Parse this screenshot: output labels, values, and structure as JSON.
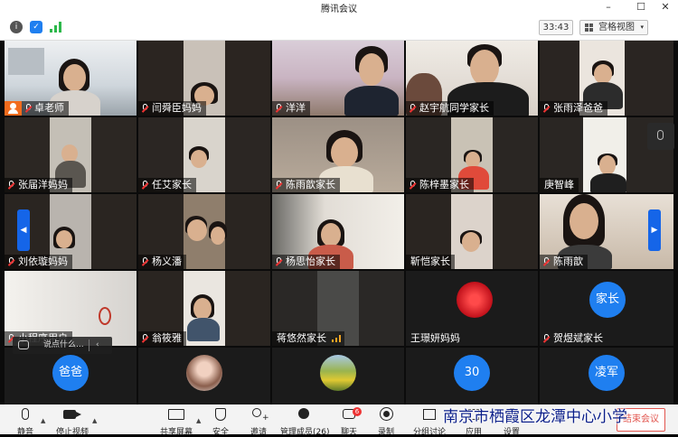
{
  "window": {
    "title": "腾讯会议",
    "minimize": "–",
    "maximize": "☐",
    "close": "✕"
  },
  "infobar": {
    "timer": "33:43",
    "view_label": "宫格视图"
  },
  "participants": [
    {
      "name": "卓老师",
      "host": true
    },
    {
      "name": "闫舜臣妈妈"
    },
    {
      "name": "洋洋"
    },
    {
      "name": "赵宇航同学家长"
    },
    {
      "name": "张雨泽爸爸"
    },
    {
      "name": "张届洋妈妈"
    },
    {
      "name": "任艾家长"
    },
    {
      "name": "陈雨歆家长"
    },
    {
      "name": "陈梓墨家长"
    },
    {
      "name": "庚智峰"
    },
    {
      "name": "刘依璇妈妈"
    },
    {
      "name": "杨义潘"
    },
    {
      "name": "杨思怡家长"
    },
    {
      "name": "靳恺家长"
    },
    {
      "name": "陈雨歆"
    },
    {
      "name": "小程序用户"
    },
    {
      "name": "翁筱雅"
    },
    {
      "name": "蒋悠然家长"
    },
    {
      "name": "王璟妍妈妈"
    },
    {
      "name": "贺煜斌家长",
      "avatar_text": "家长"
    },
    {
      "name": "",
      "avatar_text": "爸爸"
    },
    {
      "name": ""
    },
    {
      "name": ""
    },
    {
      "name": "",
      "avatar_text": "30"
    },
    {
      "name": "",
      "avatar_text": "凌军"
    }
  ],
  "chat_overlay": {
    "placeholder": "说点什么..."
  },
  "toolbar": {
    "items": [
      {
        "label": "静音",
        "icon": "mic-icon"
      },
      {
        "label": "停止视频",
        "icon": "camera-icon"
      },
      {
        "label": "共享屏幕",
        "icon": "screen-share-icon"
      },
      {
        "label": "安全",
        "icon": "shield-icon"
      },
      {
        "label": "邀请",
        "icon": "add-person-icon"
      },
      {
        "label": "管理成员(26)",
        "icon": "members-icon"
      },
      {
        "label": "聊天",
        "icon": "chat-icon",
        "badge": "6"
      },
      {
        "label": "录制",
        "icon": "record-icon"
      },
      {
        "label": "分组讨论",
        "icon": "breakout-icon"
      },
      {
        "label": "应用",
        "icon": "apps-icon"
      },
      {
        "label": "设置",
        "icon": "settings-icon"
      }
    ],
    "end_label": "结束会议"
  },
  "watermark": "南京市栖霞区龙潭中心小学",
  "colors": {
    "accent": "#1f7ff0",
    "host_badge": "#f26b1d",
    "end_button": "#e2554e"
  }
}
